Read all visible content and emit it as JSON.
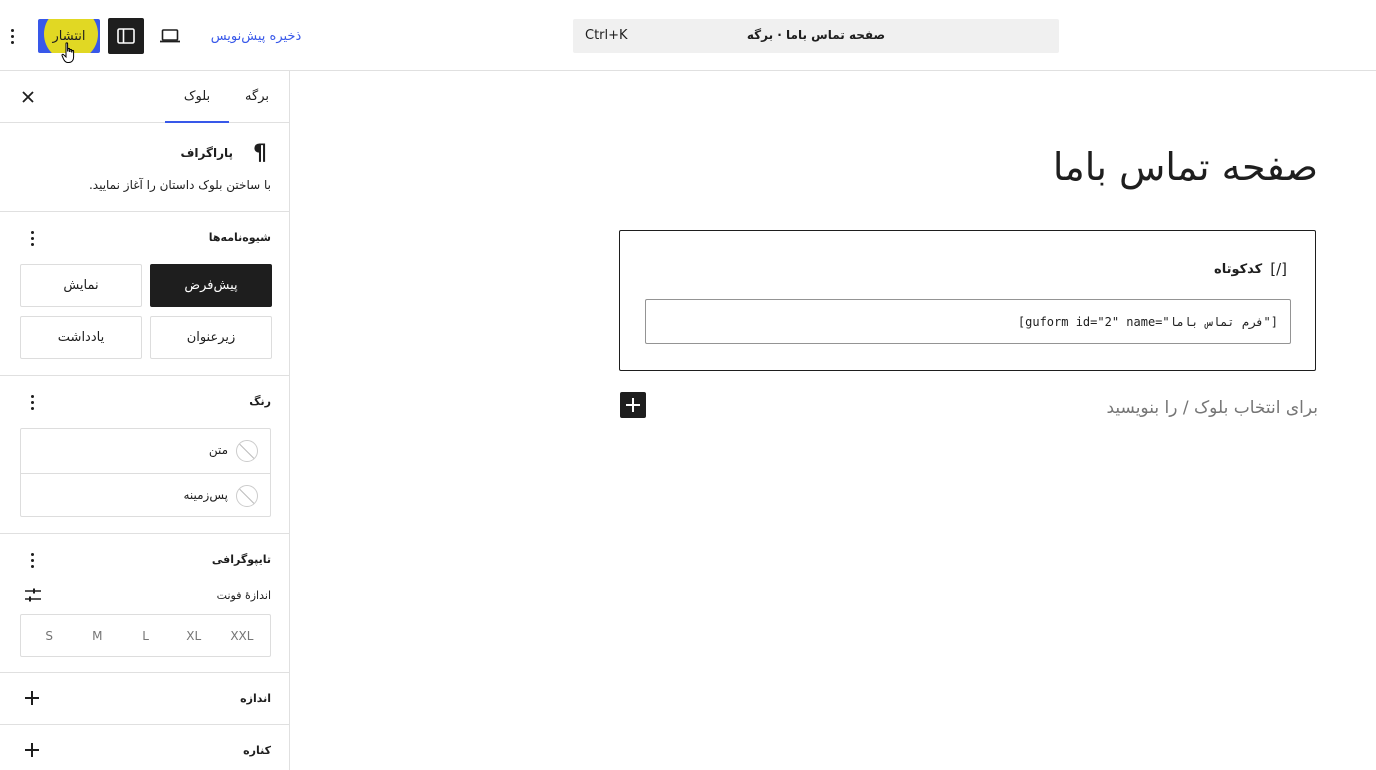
{
  "toolbar": {
    "publish_label": "انتشار",
    "save_draft_label": "ذخیره پیش‌نویس",
    "command_shortcut": "Ctrl+K",
    "document_title": "صفحه تماس باما · برگه"
  },
  "sidebar": {
    "tabs": {
      "page": "برگه",
      "block": "بلوک"
    },
    "block_card": {
      "name": "پاراگراف",
      "description": "با ساختن بلوک داستان را آغاز نمایید."
    },
    "styles": {
      "title": "شیوه‌نامه‌ها",
      "options": [
        "پیش‌فرض",
        "نمایش",
        "زیرعنوان",
        "یادداشت"
      ],
      "active": "پیش‌فرض"
    },
    "color": {
      "title": "رنگ",
      "items": [
        "متن",
        "پس‌زمینه"
      ]
    },
    "typography": {
      "title": "تایپوگرافی",
      "font_size_label": "اندازهٔ فونت",
      "sizes": [
        "S",
        "M",
        "L",
        "XL",
        "XXL"
      ]
    },
    "dimensions": {
      "title": "اندازه"
    },
    "border": {
      "title": "کناره"
    }
  },
  "canvas": {
    "page_title": "صفحه تماس باما",
    "shortcode": {
      "icon": "[/]",
      "label": "کدکوتاه",
      "value": "[guform id=\"2\" name=\"فرم تماس باما\"]"
    },
    "placeholder": "برای انتخاب بلوک / را بنویسید"
  },
  "colors": {
    "accent": "#3858e9",
    "highlight": "#ffee00",
    "dark": "#1e1e1e"
  }
}
